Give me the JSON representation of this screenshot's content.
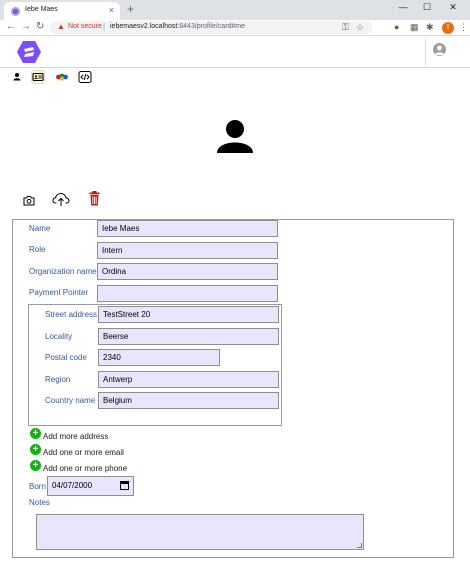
{
  "browser": {
    "tab_title": "Iebe Maes",
    "tab_close": "×",
    "new_tab": "+",
    "not_secure": "Not secure",
    "url_host": "iebemaesv2.localhost",
    "url_rest": ":8443/profile/card#me",
    "profile_initial": "I"
  },
  "app": {
    "logo_color": "#7c4dff"
  },
  "views": [
    {
      "icon": "person-icon",
      "active": false
    },
    {
      "icon": "id-card-icon",
      "active": true
    },
    {
      "icon": "people-group-icon",
      "active": false
    },
    {
      "icon": "code-icon",
      "active": false
    }
  ],
  "actions": [
    {
      "icon": "camera-icon"
    },
    {
      "icon": "cloud-upload-icon"
    },
    {
      "icon": "trash-icon",
      "color": "#cc1111"
    }
  ],
  "form": {
    "name_label": "Name",
    "name_value": "Iebe Maes",
    "role_label": "Role",
    "role_value": "Intern",
    "org_label": "Organization name",
    "org_value": "Ordina",
    "payment_label": "Payment Pointer",
    "payment_value": "",
    "address": {
      "street_label": "Street address",
      "street_value": "TestStreet 20",
      "locality_label": "Locality",
      "locality_value": "Beerse",
      "postal_label": "Postal code",
      "postal_value": "2340",
      "region_label": "Region",
      "region_value": "Antwerp",
      "country_label": "Country name",
      "country_value": "Belgium"
    },
    "add_address": "Add more address",
    "add_email": "Add one or more email",
    "add_phone": "Add one or more phone",
    "born_label": "Born",
    "born_value": "04/07/2000",
    "notes_label": "Notes",
    "notes_value": ""
  },
  "colors": {
    "label": "#37589a",
    "field_bg": "#e8e6fc",
    "add_green": "#11b311",
    "delete_red": "#cc1111"
  }
}
